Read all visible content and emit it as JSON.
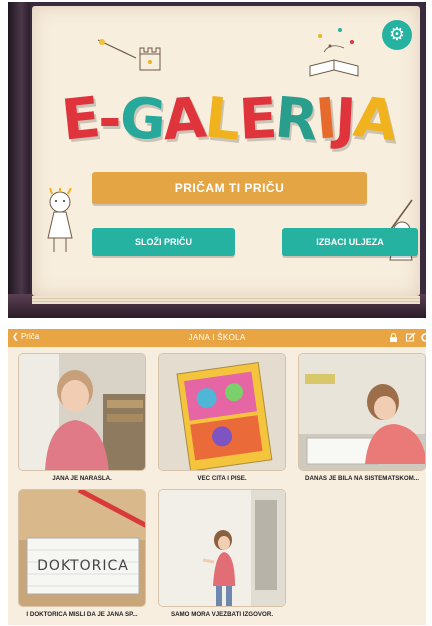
{
  "menu": {
    "logo": "E-GALERIJA",
    "logo_colors": [
      "#e0343c",
      "#e0343c",
      "#26a99a",
      "#e0343c",
      "#f0b31e",
      "#e0343c",
      "#2a9e8c",
      "#e66a2c",
      "#e0343c",
      "#f0b31e"
    ],
    "settings_icon": "gear-icon",
    "buttons": {
      "story": "PRIČAM TI PRIČU",
      "compose": "SLOŽI PRIČU",
      "intruder": "IZBACI ULJEZA"
    }
  },
  "gallery": {
    "back_label": "Priča",
    "title": "JANA I ŠKOLA",
    "toolbar_icons": [
      "lock-icon",
      "edit-icon",
      "settings-icon"
    ],
    "tiles": [
      {
        "caption": "JANA JE NARASLA."
      },
      {
        "caption": "VEĆ ČITA I PIŠE."
      },
      {
        "caption": "DANAS JE BILA NA SISTEMATSKOM..."
      },
      {
        "caption": "I DOKTORICA MISLI DA JE JANA SP..."
      },
      {
        "caption": "SAMO MORA VJEŽBATI IZGOVOR."
      }
    ]
  },
  "colors": {
    "orange": "#e4a644",
    "teal": "#26b2a0",
    "paper": "#f8eede"
  }
}
